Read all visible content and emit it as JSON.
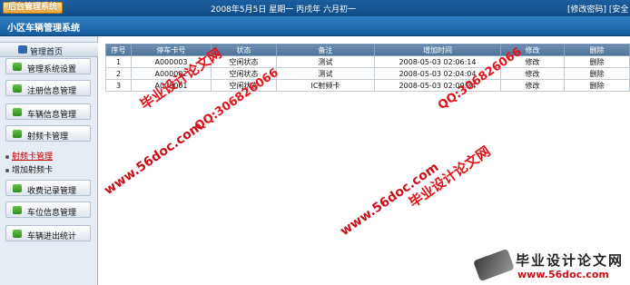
{
  "header": {
    "logo_text": "后台管理系统",
    "date_text": "2008年5月5日 星期一 丙戌年 六月初一",
    "link_change_password": "[修改密码]",
    "link_secure_exit": "[安全"
  },
  "subheader": {
    "title": "小区车辆管理系统"
  },
  "sidebar": {
    "home_label": "管理首页",
    "items": [
      {
        "label": "管理系统设置"
      },
      {
        "label": "注册信息管理"
      },
      {
        "label": "车辆信息管理"
      },
      {
        "label": "射频卡管理"
      },
      {
        "label": "收费记录管理"
      },
      {
        "label": "车位信息管理"
      },
      {
        "label": "车辆进出统计"
      }
    ],
    "sub_items": [
      {
        "label": "射频卡管理"
      },
      {
        "label": "增加射频卡"
      }
    ]
  },
  "table": {
    "columns": [
      "序号",
      "停车卡号",
      "状态",
      "备注",
      "增加时间",
      "修改",
      "删除"
    ],
    "rows": [
      {
        "no": "1",
        "card": "A000003",
        "status": "空闲状态",
        "note": "测试",
        "time": "2008-05-03 02:06:14",
        "edit": "修改",
        "delete": "删除"
      },
      {
        "no": "2",
        "card": "A000002",
        "status": "空闲状态",
        "note": "测试",
        "time": "2008-05-03 02:04:04",
        "edit": "修改",
        "delete": "删除"
      },
      {
        "no": "3",
        "card": "A000001",
        "status": "空闲状态",
        "note": "IC射频卡",
        "time": "2008-05-03 02:00:34",
        "edit": "修改",
        "delete": "删除"
      }
    ]
  },
  "watermarks": {
    "site_name": "毕业设计论文网",
    "site_url": "www.56doc.com",
    "qq": "QQ:306826066"
  },
  "brand": {
    "name": "毕业设计论文网",
    "url": "www.56doc.com"
  },
  "colors": {
    "header_bg": "#155d9f",
    "sidebar_bg": "#e6ecf3",
    "table_header_bg": "#5a7ea5",
    "watermark_red": "#e0141b"
  }
}
